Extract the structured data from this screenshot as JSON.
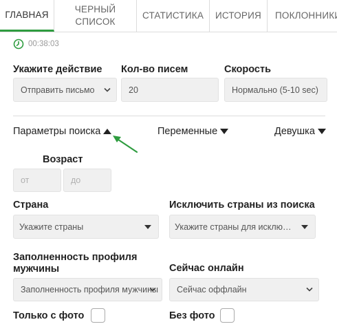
{
  "tabs": [
    {
      "label": "ГЛАВНАЯ",
      "active": true
    },
    {
      "label": "ЧЕРНЫЙ СПИСОК",
      "active": false
    },
    {
      "label": "СТАТИСТИКА",
      "active": false
    },
    {
      "label": "ИСТОРИЯ",
      "active": false
    },
    {
      "label": "ПОКЛОННИКИ",
      "active": false
    }
  ],
  "timer": {
    "value": "00:38:03",
    "icon": "clock-icon"
  },
  "action": {
    "label": "Укажите действие",
    "selected": "Отправить письмо"
  },
  "count": {
    "label": "Кол-во писем",
    "value": "20"
  },
  "speed": {
    "label": "Скорость",
    "selected": "Нормально (5-10 sec)"
  },
  "toggles": {
    "search_params": "Параметры поиска",
    "variables": "Переменные",
    "girl": "Девушка"
  },
  "age": {
    "label": "Возраст",
    "from_placeholder": "от",
    "to_placeholder": "до"
  },
  "country": {
    "label": "Страна",
    "placeholder": "Укажите страны"
  },
  "exclude_country": {
    "label": "Исключить страны из поиска",
    "placeholder": "Укажите страны для исклю…"
  },
  "profile_fill": {
    "label": "Заполненность профиля мужчины",
    "selected": "Заполненность профиля мужчины"
  },
  "online": {
    "label": "Сейчас онлайн",
    "selected": "Сейчас оффлайн"
  },
  "photo_only": {
    "label": "Только с фото",
    "checked": false
  },
  "no_photo": {
    "label": "Без фото",
    "checked": false
  },
  "colors": {
    "accent": "#2e9c3f",
    "field_bg": "#f0f0f0"
  }
}
